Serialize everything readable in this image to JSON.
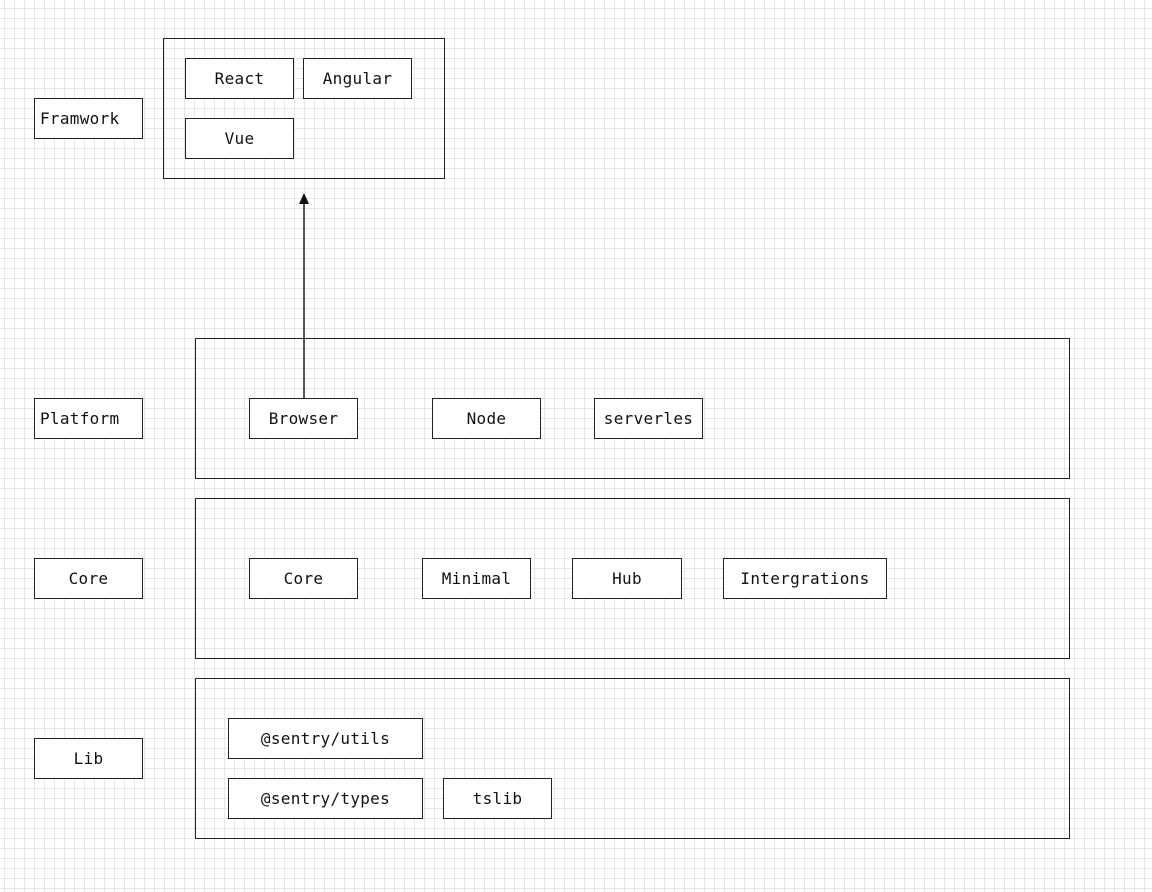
{
  "layers": {
    "framework": "Framwork",
    "platform": "Platform",
    "core": "Core",
    "lib": "Lib"
  },
  "framework_group": [
    "React",
    "Angular",
    "Vue"
  ],
  "platform_group": [
    "Browser",
    "Node",
    "serverles"
  ],
  "core_group": [
    "Core",
    "Minimal",
    "Hub",
    "Intergrations"
  ],
  "lib_group": [
    "@sentry/utils",
    "@sentry/types",
    "tslib"
  ],
  "edges": [
    {
      "from": "Browser",
      "to": "Framework group",
      "style": "arrow"
    }
  ]
}
